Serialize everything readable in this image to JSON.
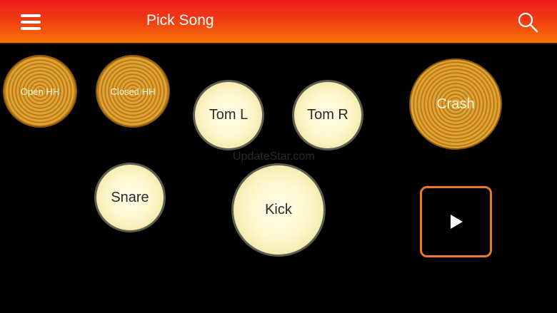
{
  "header": {
    "title": "Pick Song",
    "menu_icon": "hamburger-menu-icon",
    "search_icon": "search-icon",
    "bar_color_top": "#ec1c1c",
    "bar_color_bottom": "#f7740a"
  },
  "watermark": "UpdateStar.com",
  "pads": {
    "open_hh": "Open HH",
    "closed_hh": "Closed HH",
    "tom_l": "Tom L",
    "tom_r": "Tom R",
    "crash": "Crash",
    "snare": "Snare",
    "kick": "Kick"
  },
  "colors": {
    "cymbal": "#e0a233",
    "drum": "#fff8cf",
    "play_border": "#e8782a"
  },
  "controls": {
    "play_icon": "play-icon"
  }
}
